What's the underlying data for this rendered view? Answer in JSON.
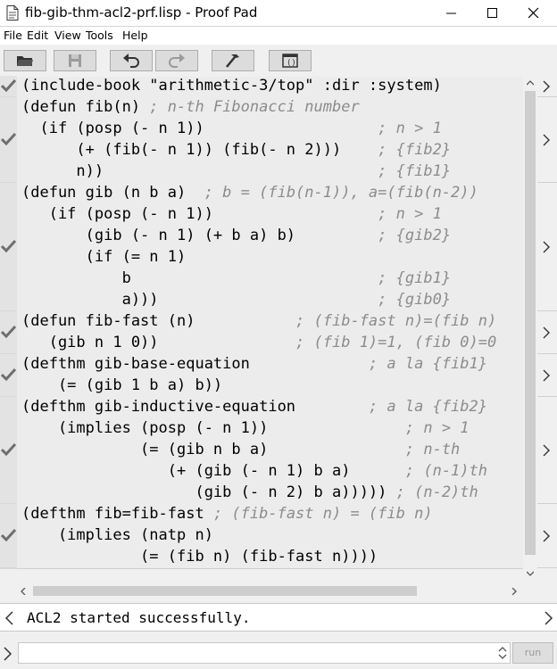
{
  "window": {
    "title": "fib-gib-thm-acl2-prf.lisp - Proof Pad"
  },
  "menu": {
    "items": [
      "File",
      "Edit",
      "View",
      "Tools",
      "Help"
    ]
  },
  "toolbar": {
    "buttons": [
      "open-folder-icon",
      "save-icon",
      "undo-icon",
      "redo-icon",
      "build-hammer-icon",
      "acl2-console-icon"
    ]
  },
  "editor": {
    "lines": [
      {
        "code": "(include-book \"arithmetic-3/top\" :dir :system)",
        "comment": ""
      },
      {
        "code": "(defun fib(n) ",
        "comment": "; n-th Fibonacci number"
      },
      {
        "code": "  (if (posp (- n 1))                   ",
        "comment": "; n > 1"
      },
      {
        "code": "      (+ (fib(- n 1)) (fib(- n 2)))    ",
        "comment": "; {fib2}"
      },
      {
        "code": "      n))                              ",
        "comment": "; {fib1}"
      },
      {
        "code": "(defun gib (n b a)  ",
        "comment": "; b = (fib(n-1)), a=(fib(n-2))"
      },
      {
        "code": "   (if (posp (- n 1))                  ",
        "comment": "; n > 1"
      },
      {
        "code": "       (gib (- n 1) (+ b a) b)         ",
        "comment": "; {gib2}"
      },
      {
        "code": "       (if (= n 1)",
        "comment": ""
      },
      {
        "code": "           b                           ",
        "comment": "; {gib1}"
      },
      {
        "code": "           a)))                        ",
        "comment": "; {gib0}"
      },
      {
        "code": "(defun fib-fast (n)           ",
        "comment": "; (fib-fast n)=(fib n)"
      },
      {
        "code": "   (gib n 1 0))               ",
        "comment": "; (fib 1)=1, (fib 0)=0"
      },
      {
        "code": "(defthm gib-base-equation             ",
        "comment": "; a la {fib1}"
      },
      {
        "code": "    (= (gib 1 b a) b))",
        "comment": ""
      },
      {
        "code": "(defthm gib-inductive-equation        ",
        "comment": "; a la {fib2}"
      },
      {
        "code": "    (implies (posp (- n 1))               ",
        "comment": "; n > 1"
      },
      {
        "code": "             (= (gib n b a)               ",
        "comment": "; n-th"
      },
      {
        "code": "                (+ (gib (- n 1) b a)      ",
        "comment": "; (n-1)th"
      },
      {
        "code": "                   (gib (- n 2) b a))))) ",
        "comment": "; (n-2)th"
      },
      {
        "code": "(defthm fib=fib-fast ",
        "comment": "; (fib-fast n) = (fib n)"
      },
      {
        "code": "    (implies (natp n)",
        "comment": ""
      },
      {
        "code": "             (= (fib n) (fib-fast n))))",
        "comment": ""
      },
      {
        "code": "",
        "comment": ""
      }
    ],
    "blocks": [
      {
        "start": 0,
        "end": 0
      },
      {
        "start": 1,
        "end": 4
      },
      {
        "start": 5,
        "end": 10
      },
      {
        "start": 11,
        "end": 12
      },
      {
        "start": 13,
        "end": 14
      },
      {
        "start": 15,
        "end": 19
      },
      {
        "start": 20,
        "end": 22
      }
    ]
  },
  "output": {
    "text": "ACL2 started successfully."
  },
  "input": {
    "value": "",
    "run_label": "run"
  },
  "colors": {
    "comment": "#8c8c8c",
    "check": "#6e6e6e",
    "gutter": "#d8d8d8"
  }
}
